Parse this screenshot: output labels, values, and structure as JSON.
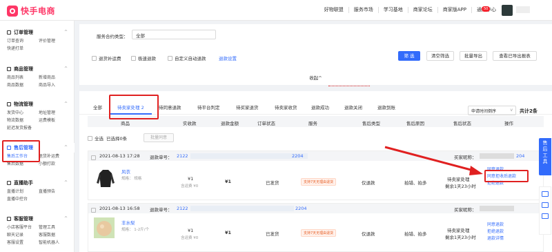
{
  "header": {
    "brand": "快手电商",
    "nav": [
      "好物联盟",
      "服务市场",
      "学习基地",
      "商家论坛",
      "商家版APP",
      "通知中心"
    ],
    "badge": "50"
  },
  "sidebar": [
    {
      "title": "订单管理",
      "items": [
        "订单查询",
        "评价管理",
        "快递打单"
      ]
    },
    {
      "title": "商品管理",
      "items": [
        "商品列表",
        "新增商品",
        "商品数据",
        "商品导入"
      ]
    },
    {
      "title": "物流管理",
      "items": [
        "发货中心",
        "地址管理",
        "物流数据",
        "运费模板",
        "延迟发货报备"
      ]
    },
    {
      "title": "售后管理",
      "items": [
        "售后工作台",
        "退货补运费",
        "售后数据",
        "小额打款"
      ]
    },
    {
      "title": "直播助手",
      "items": [
        "直播计划",
        "直播预告",
        "直播中控台"
      ]
    },
    {
      "title": "客服管理",
      "items": [
        "小店客服平台",
        "管理工具",
        "聊天记录",
        "客服数据",
        "客服设置",
        "智能机器人"
      ]
    }
  ],
  "filter": {
    "contract_label": "服务合约类型：",
    "contract_value": "全部",
    "checks": [
      "退货补运费",
      "极速退款",
      "自定义自动退款"
    ],
    "refund_settings": "退款设置",
    "buttons": [
      "筛 选",
      "清空筛选",
      "批量导出",
      "查看已导出报表"
    ],
    "collapse": "收起^"
  },
  "tabs": [
    "全部",
    "待卖家处理 2",
    "待同意退款",
    "待平台判定",
    "待买家退货",
    "待卖家收货",
    "退款成功",
    "退款关闭",
    "退款到账"
  ],
  "sort": "申请时间倒序",
  "total": "共计2条",
  "columns": [
    "商品",
    "实收款",
    "退款金额",
    "订单状态",
    "服务",
    "售后类型",
    "售后原因",
    "售后状态",
    "操作"
  ],
  "bulk": {
    "select_all": "全选",
    "selected": "已选择0条",
    "batch_agree": "批量同意"
  },
  "orders": [
    {
      "time": "2021-08-13 17:28",
      "refund_no_label": "退款单号：",
      "refund_no_a": "2122",
      "refund_no_b": "2204",
      "buyer_label": "买家昵称：",
      "buyer_suffix": "204",
      "product": "风衣",
      "spec": "规格： 规格",
      "paid": "¥1",
      "shipping": "含运费 ¥0",
      "refund": "¥1",
      "order_status": "已发货",
      "service": "支持7天无理由退货",
      "type": "仅退款",
      "reason": "拍错、拍多",
      "status": "待卖家处理",
      "remain": "剩余1天23小时",
      "actions": [
        "同意退款",
        "同意拒收后退款",
        "拒绝退款"
      ]
    },
    {
      "time": "2021-08-13 16:58",
      "refund_no_label": "退款单号：",
      "refund_no_a": "2122",
      "refund_no_b": "2204",
      "buyer_label": "买家昵称：",
      "buyer_suffix": "",
      "product": "丰水梨",
      "spec": "规格： 1-2斤/个",
      "paid": "¥1",
      "shipping": "含运费 ¥0",
      "refund": "¥1",
      "order_status": "已发货",
      "service": "支持7天无理由退货",
      "type": "仅退款",
      "reason": "拍错、拍多",
      "status": "待卖家处理",
      "remain": "剩余1天23小时",
      "actions": [
        "同意退款",
        "拒绝退款",
        "退款详情"
      ]
    }
  ],
  "float": {
    "label": "售后工具"
  }
}
